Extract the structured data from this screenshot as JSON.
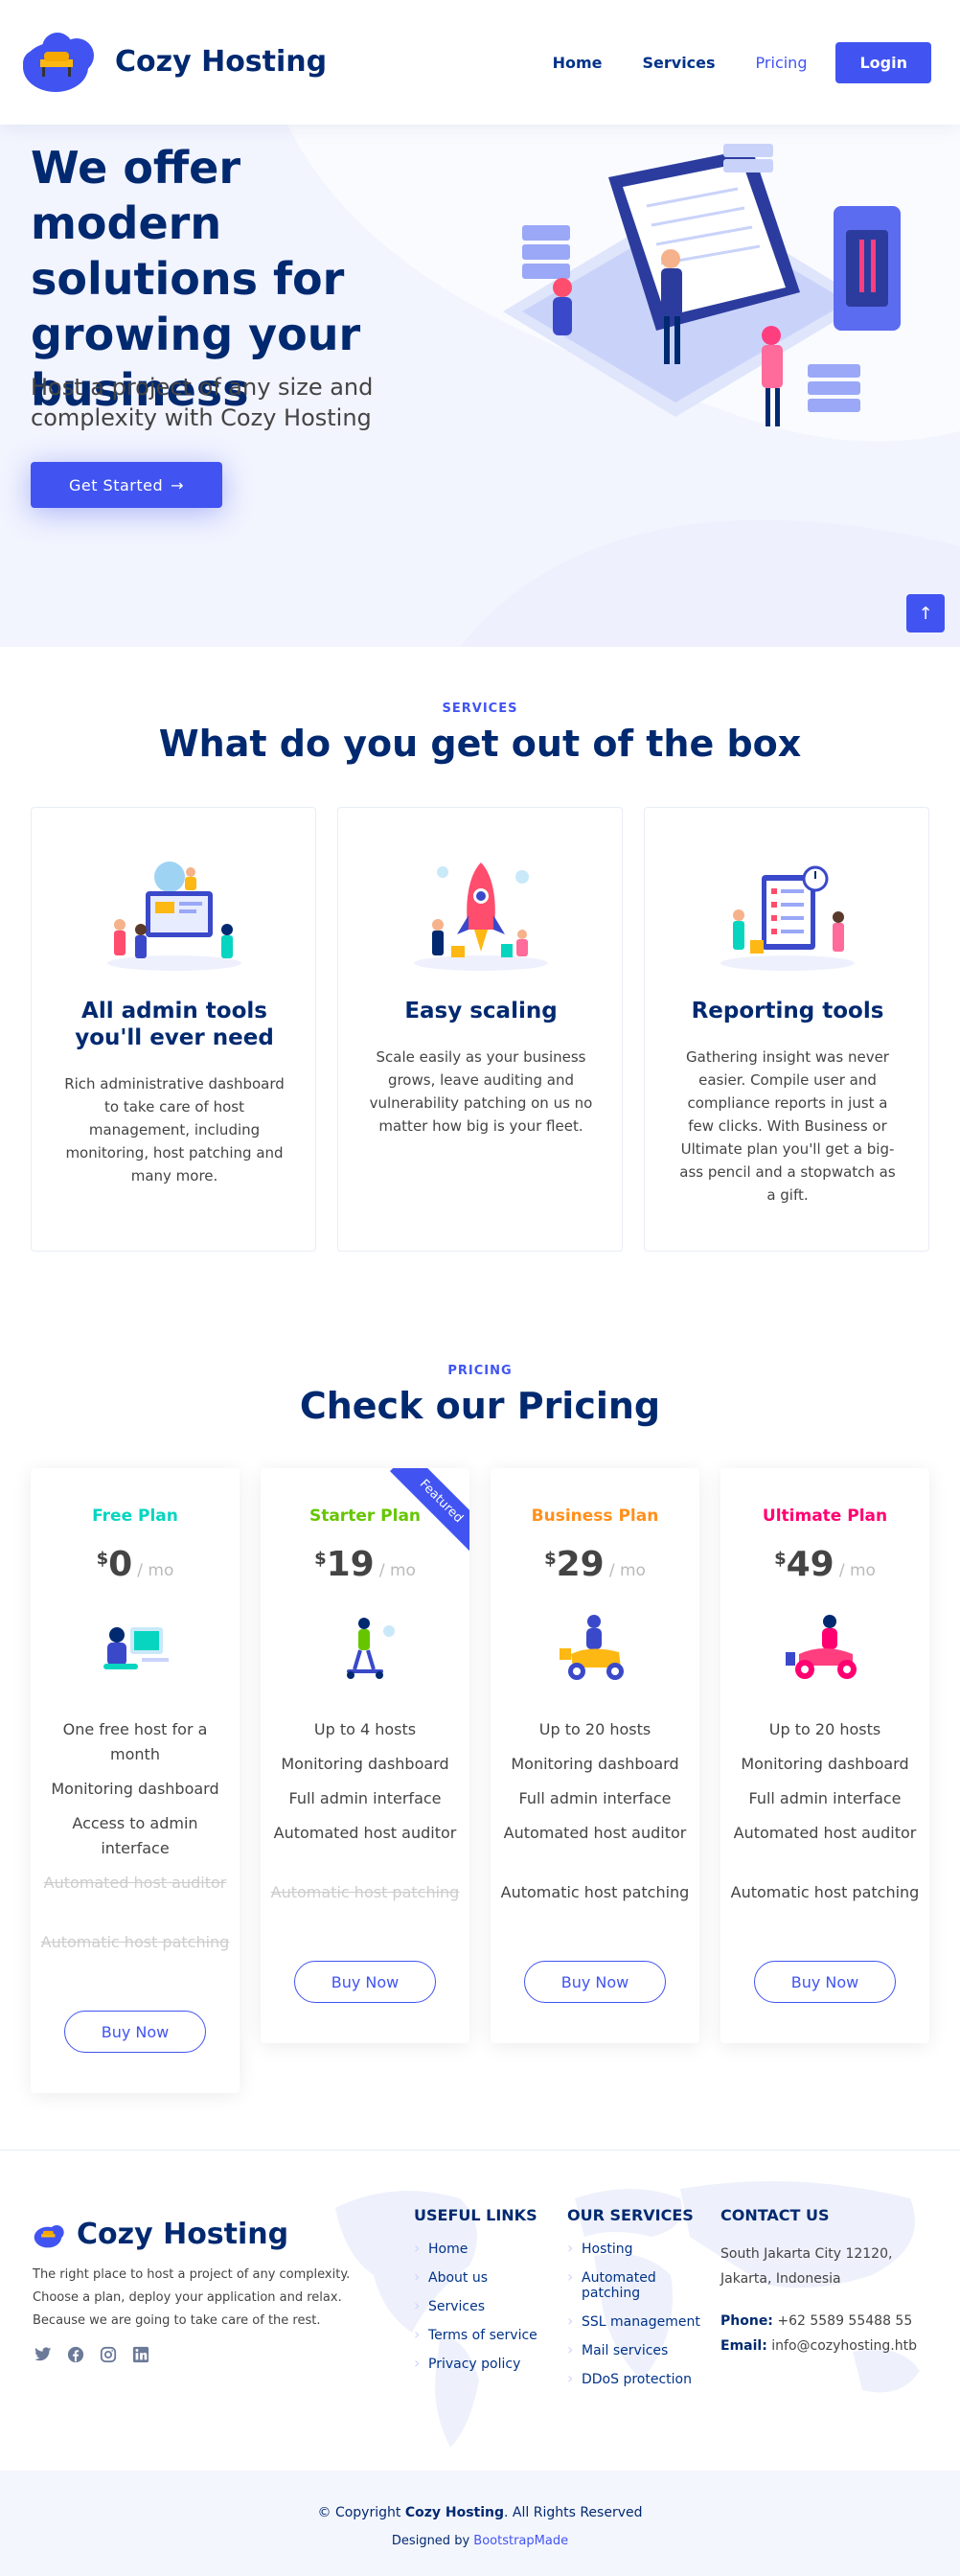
{
  "header": {
    "brand": "Cozy Hosting",
    "nav": [
      "Home",
      "Services",
      "Pricing"
    ],
    "login": "Login"
  },
  "hero": {
    "title": "We offer modern solutions for growing your business",
    "subtitle": "Host a project of any size and complexity with Cozy Hosting",
    "cta": "Get Started",
    "back_to_top_icon": "arrow-up-icon"
  },
  "services": {
    "label": "SERVICES",
    "title": "What do you get out of the box",
    "items": [
      {
        "title": "All admin tools you'll ever need",
        "text": "Rich administrative dashboard to take care of host management, including monitoring, host patching and many more."
      },
      {
        "title": "Easy scaling",
        "text": "Scale easily as your business grows, leave auditing and vulnerability patching on us no matter how big is your fleet."
      },
      {
        "title": "Reporting tools",
        "text": "Gathering insight was never easier. Compile user and compliance reports in just a few clicks. With Business or Ultimate plan you'll get a big-ass pencil and a stopwatch as a gift."
      }
    ]
  },
  "pricing": {
    "label": "PRICING",
    "title": "Check our Pricing",
    "currency": "$",
    "period": "/ mo",
    "featured": "Featured",
    "buy": "Buy Now",
    "plans": [
      {
        "name": "Free Plan",
        "color": "#07d5c0",
        "price": "0",
        "features": [
          "One free host for a month",
          "Monitoring dashboard",
          "Access to admin interface"
        ],
        "unavailable": [
          "Automated host auditor",
          "Automatic host patching"
        ]
      },
      {
        "name": "Starter Plan",
        "color": "#65c600",
        "price": "19",
        "features": [
          "Up to 4 hosts",
          "Monitoring dashboard",
          "Full admin interface",
          "Automated host auditor"
        ],
        "unavailable": [
          "Automatic host patching"
        ]
      },
      {
        "name": "Business Plan",
        "color": "#ff901c",
        "price": "29",
        "features": [
          "Up to 20 hosts",
          "Monitoring dashboard",
          "Full admin interface",
          "Automated host auditor",
          "Automatic host patching"
        ],
        "unavailable": []
      },
      {
        "name": "Ultimate Plan",
        "color": "#ff0071",
        "price": "49",
        "features": [
          "Up to 20 hosts",
          "Monitoring dashboard",
          "Full admin interface",
          "Automated host auditor",
          "Automatic host patching"
        ],
        "unavailable": []
      }
    ]
  },
  "footer": {
    "brand": "Cozy Hosting",
    "about": "The right place to host a project of any complexity. Choose a plan, deploy your application and relax. Because we are going to take care of the rest.",
    "social": [
      "twitter-icon",
      "facebook-icon",
      "instagram-icon",
      "linkedin-icon"
    ],
    "useful_links_title": "USEFUL LINKS",
    "useful_links": [
      "Home",
      "About us",
      "Services",
      "Terms of service",
      "Privacy policy"
    ],
    "services_title": "OUR SERVICES",
    "services": [
      "Hosting",
      "Automated patching",
      "SSL management",
      "Mail services",
      "DDoS protection"
    ],
    "contact_title": "CONTACT US",
    "address": "South Jakarta City 12120, Jakarta, Indonesia",
    "phone_label": "Phone:",
    "phone": "+62 5589 55488 55",
    "email_label": "Email:",
    "email": "info@cozyhosting.htb",
    "copyright_prefix": "© Copyright ",
    "copyright_brand": "Cozy Hosting",
    "copyright_suffix": ". All Rights Reserved",
    "designed_by": "Designed by ",
    "designer": "BootstrapMade"
  }
}
